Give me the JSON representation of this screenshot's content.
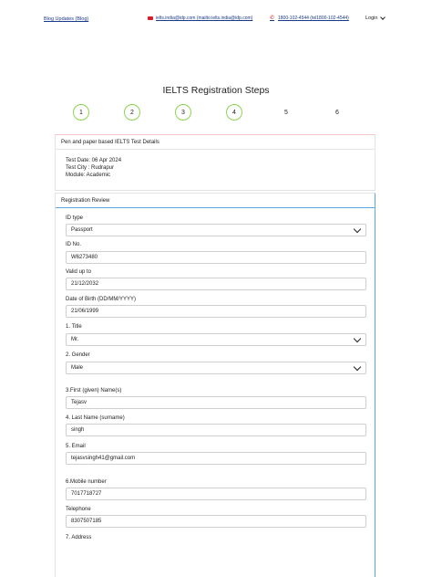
{
  "header": {
    "blog_link": "Blog Updates (Blog)",
    "email_link": "ielts.india@idp.com (mailto:ielts.india@idp.com)",
    "phone_link": "1800-102-4544 (tel1800-102-4544)",
    "login_label": "Login"
  },
  "page": {
    "title": "IELTS Registration Steps"
  },
  "steps": [
    {
      "label": "1",
      "status": "done"
    },
    {
      "label": "2",
      "status": "done"
    },
    {
      "label": "3",
      "status": "done"
    },
    {
      "label": "4",
      "status": "done"
    },
    {
      "label": "5",
      "status": "pending"
    },
    {
      "label": "6",
      "status": "pending"
    }
  ],
  "test_details": {
    "header": "Pen and paper based IELTS Test Details",
    "test_date": "Test Date: 06 Apr 2024",
    "test_city": "Test City : Rudrapur",
    "module": "Module: Academic"
  },
  "review": {
    "header": "Registration Review",
    "id_type": {
      "label": "ID type",
      "value": "Passport"
    },
    "id_no": {
      "label": "ID No.",
      "value": "W6273480"
    },
    "valid_up_to": {
      "label": "Valid up to",
      "value": "21/12/2032"
    },
    "dob": {
      "label": "Date of Birth (DD/MM/YYYY)",
      "value": "21/06/1999"
    },
    "title": {
      "label": "1. Title",
      "value": "Mr."
    },
    "gender": {
      "label": "2. Gender",
      "value": "Male"
    },
    "first_name": {
      "label": "3.First (given) Name(s)",
      "value": "Tejasv"
    },
    "last_name": {
      "label": "4. Last Name (surname)",
      "value": "singh"
    },
    "email": {
      "label": "5. Email",
      "value": "tejasvsingh41@gmail.com"
    },
    "mobile": {
      "label": "6.Mobile number",
      "value": "7017718727"
    },
    "telephone": {
      "label": "Telephone",
      "value": "8307507185"
    },
    "address": {
      "label": "7. Address"
    }
  },
  "colors": {
    "link": "#1a3a8a",
    "icon_red": "#d81e2c",
    "step_done_ring": "#8bd34f",
    "active_border": "#5aa9e6"
  }
}
